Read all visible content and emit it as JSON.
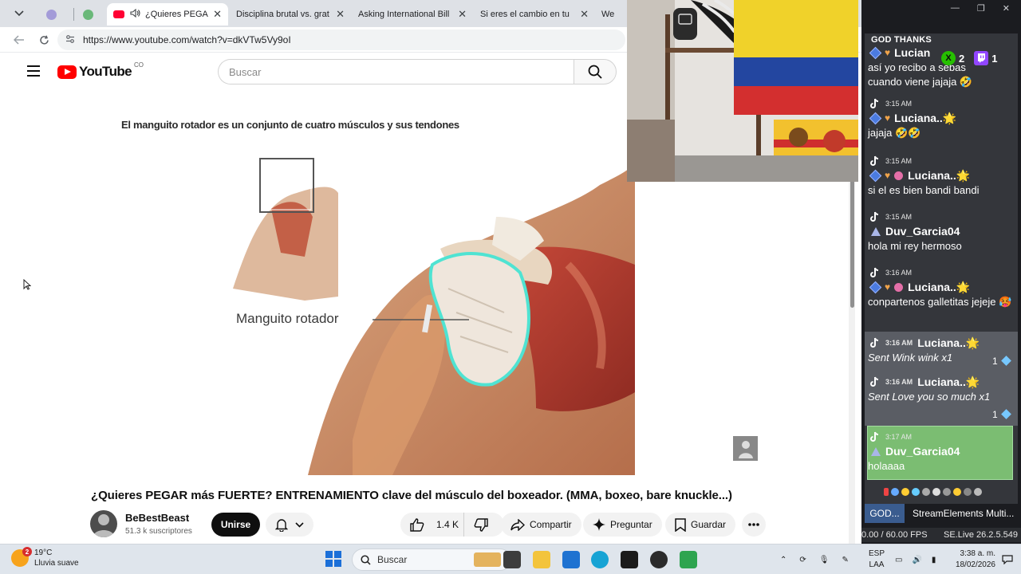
{
  "browser": {
    "tabs": [
      {
        "title": "",
        "favicon": "camera-icon",
        "active": false
      },
      {
        "title": "",
        "favicon": "green-circle-icon",
        "active": false
      },
      {
        "title": "¿Quieres PEGAR m",
        "favicon": "youtube-icon",
        "active": true,
        "audio": true
      },
      {
        "title": "Disciplina brutal vs. grat",
        "favicon": "youtube-icon",
        "active": false
      },
      {
        "title": "Asking International Bill",
        "favicon": "youtube-icon",
        "active": false
      },
      {
        "title": "Si eres el cambio en tu",
        "favicon": "youtube-icon",
        "active": false
      },
      {
        "title": "We",
        "favicon": "youtube-icon",
        "active": false
      }
    ],
    "url": "https://www.youtube.com/watch?v=dkVTw5Vy9oI"
  },
  "youtube": {
    "logo_text": "YouTube",
    "country_code": "CO",
    "search_placeholder": "Buscar",
    "video": {
      "overlay_caption": "El manguito rotador es un conjunto de cuatro músculos y sus tendones",
      "label": "Manguito rotador"
    },
    "title": "¿Quieres PEGAR más FUERTE? ENTRENAMIENTO clave del músculo del boxeador. (MMA, boxeo, bare knuckle...)",
    "channel": {
      "name": "BeBestBeast",
      "subscribers": "51.3 k suscriptores"
    },
    "actions": {
      "join": "Unirse",
      "likes": "1.4 K",
      "share": "Compartir",
      "ask": "Preguntar",
      "save": "Guardar"
    }
  },
  "chat": {
    "header": "GOD THANKS",
    "counts": {
      "x_label": "X",
      "x_count": "2",
      "twitch_count": "1"
    },
    "partial_top": {
      "user": "Lucian",
      "text": "así yo recibo a sebas cuando viene jajaja 🤣"
    },
    "messages": [
      {
        "time": "3:15 AM",
        "user": "Luciana..🌟",
        "text": "jajaja 🤣🤣"
      },
      {
        "time": "3:15 AM",
        "user": "Luciana..🌟",
        "text": "si el es bien bandi bandi"
      },
      {
        "time": "3:15 AM",
        "user": "Duv_Garcia04",
        "text": "hola mi rey hermoso"
      },
      {
        "time": "3:16 AM",
        "user": "Luciana..🌟",
        "text": "conpartenos galletitas jejeje 🥵"
      }
    ],
    "gifts": [
      {
        "time": "3:16 AM",
        "user": "Luciana..🌟",
        "text": "Sent Wink wink x1",
        "count": "1"
      },
      {
        "time": "3:16 AM",
        "user": "Luciana..🌟",
        "text": "Sent Love you so much x1",
        "count": "1"
      }
    ],
    "highlight": {
      "time": "3:17 AM",
      "user": "Duv_Garcia04",
      "text": "holaaaa"
    },
    "tabs": {
      "first": "GOD...",
      "second": "StreamElements Multi..."
    },
    "fps": "0.00 / 60.00 FPS",
    "version": "SE.Live 26.2.5.549"
  },
  "taskbar": {
    "weather": {
      "badge": "2",
      "temp": "19°C",
      "condition": "Lluvia suave"
    },
    "search_placeholder": "Buscar",
    "language": {
      "line1": "ESP",
      "line2": "LAA"
    },
    "clock": {
      "time": "3:38 a. m.",
      "date": "18/02/2026"
    }
  },
  "colors": {
    "youtube_red": "#ff0000",
    "chat_bg": "#34363b",
    "highlight_green": "#7bbd72",
    "twitch_purple": "#9146ff"
  }
}
